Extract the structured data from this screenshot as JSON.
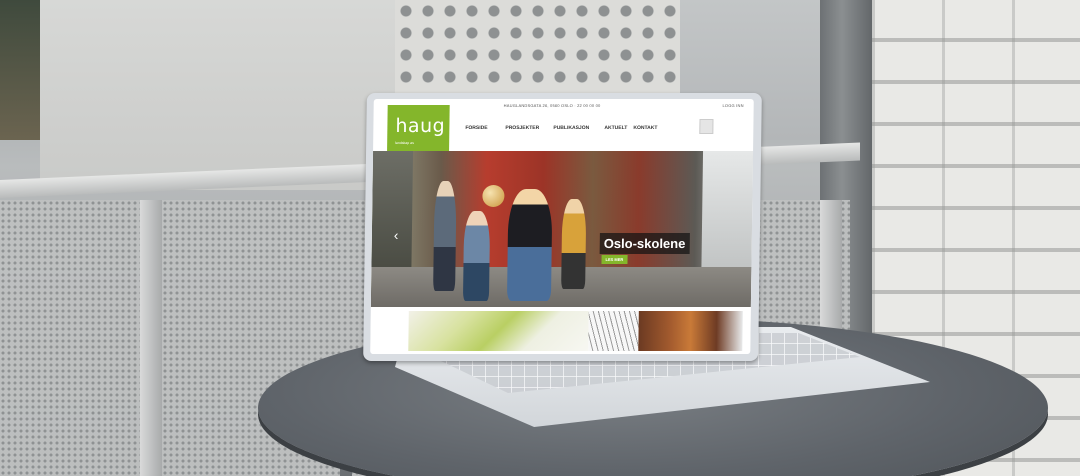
{
  "site": {
    "topbar_contact": "HAUGLANDSGATA 26, 0560 OSLO · 22 00 00 00",
    "topbar_login": "LOGG INN",
    "logo_text": "haug",
    "logo_subtitle": "landskap as",
    "nav": {
      "items": [
        {
          "label": "FORSIDE"
        },
        {
          "label": "PROSJEKTER"
        },
        {
          "label": "PUBLIKASJON"
        },
        {
          "label": "AKTUELT"
        },
        {
          "label": "KONTAKT"
        }
      ]
    },
    "hero": {
      "title": "Oslo-skolene",
      "button_label": "LES MER"
    }
  },
  "colors": {
    "brand_green": "#84b62b",
    "table": "#5f646a",
    "laptop": "#d9dde2"
  },
  "icons": [
    "search-icon",
    "chevron-left-icon"
  ]
}
